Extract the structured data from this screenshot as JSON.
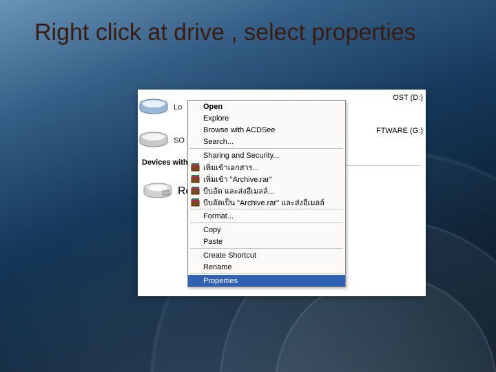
{
  "title": "Right click at drive , select properties",
  "drives": {
    "local_txt": "Lo",
    "soft_txt": "SO",
    "rem_txt": "Re",
    "d_label": "OST (D:)",
    "g_label": "FTWARE (G:)"
  },
  "section_header": "Devices with",
  "menu": {
    "open": "Open",
    "explore": "Explore",
    "acdsee": "Browse with ACDSee",
    "search": "Search...",
    "sharing": "Sharing and Security...",
    "rar1": "เพิ่มเข้าเอกสาร...",
    "rar2": "เพิ่มเข้า \"Archive.rar\"",
    "rar3": "บีบอัด และส่งอีเมลล์...",
    "rar4": "บีบอัดเป็น \"Archive.rar\" และส่งอีเมลล์",
    "format": "Format...",
    "copy": "Copy",
    "paste": "Paste",
    "shortcut": "Create Shortcut",
    "rename": "Rename",
    "properties": "Properties"
  }
}
